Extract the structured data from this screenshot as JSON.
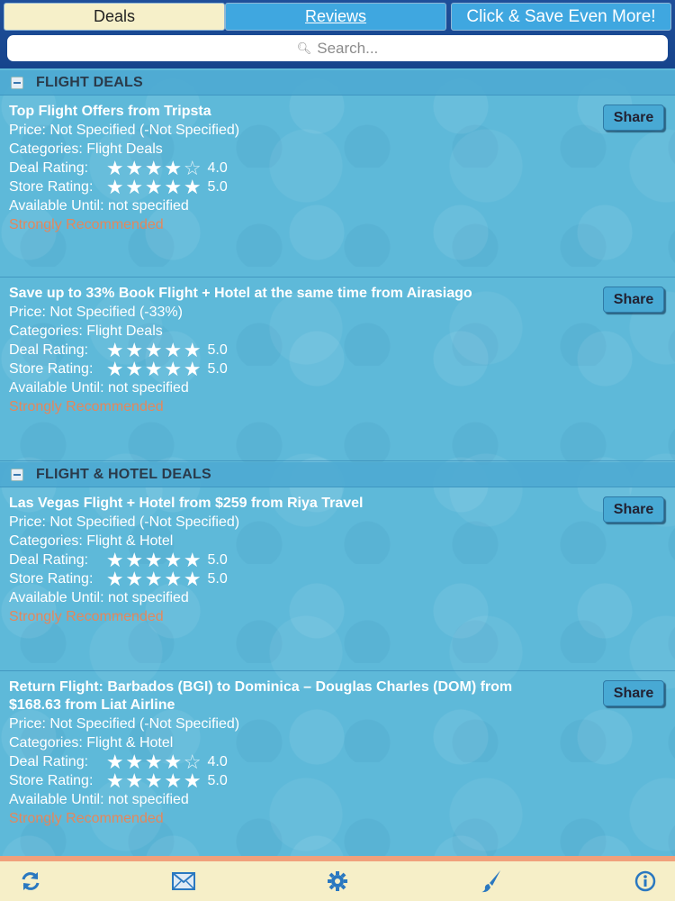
{
  "tabs": {
    "deals": "Deals",
    "reviews": "Reviews",
    "promo": "Click & Save Even More!"
  },
  "search": {
    "placeholder": "Search..."
  },
  "sections": [
    {
      "title": "FLIGHT DEALS",
      "deals": [
        {
          "title": "Top Flight Offers from Tripsta",
          "price": "Price: Not Specified (-Not Specified)",
          "categories": "Categories: Flight Deals",
          "deal_rating_label": "Deal Rating:",
          "deal_rating": 4.0,
          "deal_rating_text": "4.0",
          "store_rating_label": "Store Rating:",
          "store_rating": 5.0,
          "store_rating_text": "5.0",
          "available": "Available Until: not specified",
          "recommendation": "Strongly Recommended",
          "share": "Share"
        },
        {
          "title": "Save up to 33% Book Flight + Hotel at the same time from Airasiago",
          "price": "Price: Not Specified (-33%)",
          "categories": "Categories: Flight Deals",
          "deal_rating_label": "Deal Rating:",
          "deal_rating": 5.0,
          "deal_rating_text": "5.0",
          "store_rating_label": "Store Rating:",
          "store_rating": 5.0,
          "store_rating_text": "5.0",
          "available": "Available Until: not specified",
          "recommendation": "Strongly Recommended",
          "share": "Share"
        }
      ]
    },
    {
      "title": "FLIGHT & HOTEL DEALS",
      "deals": [
        {
          "title": "Las Vegas Flight + Hotel from $259 from Riya Travel",
          "price": "Price: Not Specified (-Not Specified)",
          "categories": "Categories: Flight & Hotel",
          "deal_rating_label": "Deal Rating:",
          "deal_rating": 5.0,
          "deal_rating_text": "5.0",
          "store_rating_label": "Store Rating:",
          "store_rating": 5.0,
          "store_rating_text": "5.0",
          "available": "Available Until: not specified",
          "recommendation": "Strongly Recommended",
          "share": "Share"
        },
        {
          "title": "Return Flight: Barbados (BGI) to Dominica – Douglas Charles (DOM) from",
          "title2": "$168.63 from Liat Airline",
          "price": "Price: Not Specified (-Not Specified)",
          "categories": "Categories: Flight & Hotel",
          "deal_rating_label": "Deal Rating:",
          "deal_rating": 4.0,
          "deal_rating_text": "4.0",
          "store_rating_label": "Store Rating:",
          "store_rating": 5.0,
          "store_rating_text": "5.0",
          "available": "Available Until: not specified",
          "recommendation": "Strongly Recommended",
          "share": "Share"
        }
      ]
    }
  ],
  "toolbar": {
    "icons": [
      "refresh-icon",
      "mail-icon",
      "settings-gear-icon",
      "brush-icon",
      "info-icon"
    ]
  },
  "colors": {
    "accent_blue": "#3fa7e0",
    "recommended": "#e4875c",
    "toolbar_bg": "#f6efc8"
  }
}
